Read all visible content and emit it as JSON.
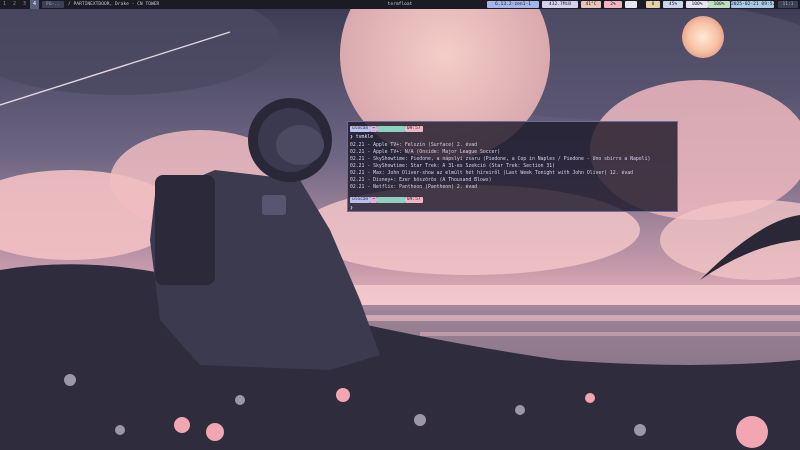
{
  "topbar": {
    "workspaces": [
      "1",
      "2",
      "3",
      "4"
    ],
    "active_workspace": "4",
    "window_tag": "FG-..",
    "window_title": "/ PARTINEXTDOOR, Drake · CN TOWER",
    "center_title": "termfloat",
    "status": {
      "kernel": "6.13.2-zen1-1",
      "memory": "432.7MiB",
      "temp": "41°C",
      "cpu": "2%",
      "updates": "0",
      "volume": "45%",
      "brightness": "100%",
      "battery": "100%",
      "datetime": "2025-02-21 09:57",
      "tray": "11:1"
    }
  },
  "terminal": {
    "prompt": {
      "user": "ulocan",
      "dir": "~",
      "time": "09:57"
    },
    "command": "❯ tvmkle",
    "output": [
      "02.21 - Apple TV+: Felszín (Surface) 2. évad",
      "02.21 - Apple TV+: N/A (Onside: Major League Soccer)",
      "02.21 - SkyShowtime: Piedone, a nápslyi zsaru (Piedone, a Cop in Naples / Piedone - Uno sbirro a Napoli)",
      "02.21 - SkyShowtime: Star Trek: A 31-es Szekció (Star Trek: Section 31)",
      "02.21 - Max: John Oliver-show az elmúlt hét híreiről (Last Week Tonight with John Oliver) 12. évad",
      "02.21 - Disney+: Ezer böszörös (A Thousand Blows)",
      "02.21 - Netflix: Pantheon (Pantheon) 2. évad"
    ],
    "prompt2": {
      "user": "ulocan",
      "dir": "~",
      "time": "09:57"
    },
    "cursor": "❯"
  }
}
